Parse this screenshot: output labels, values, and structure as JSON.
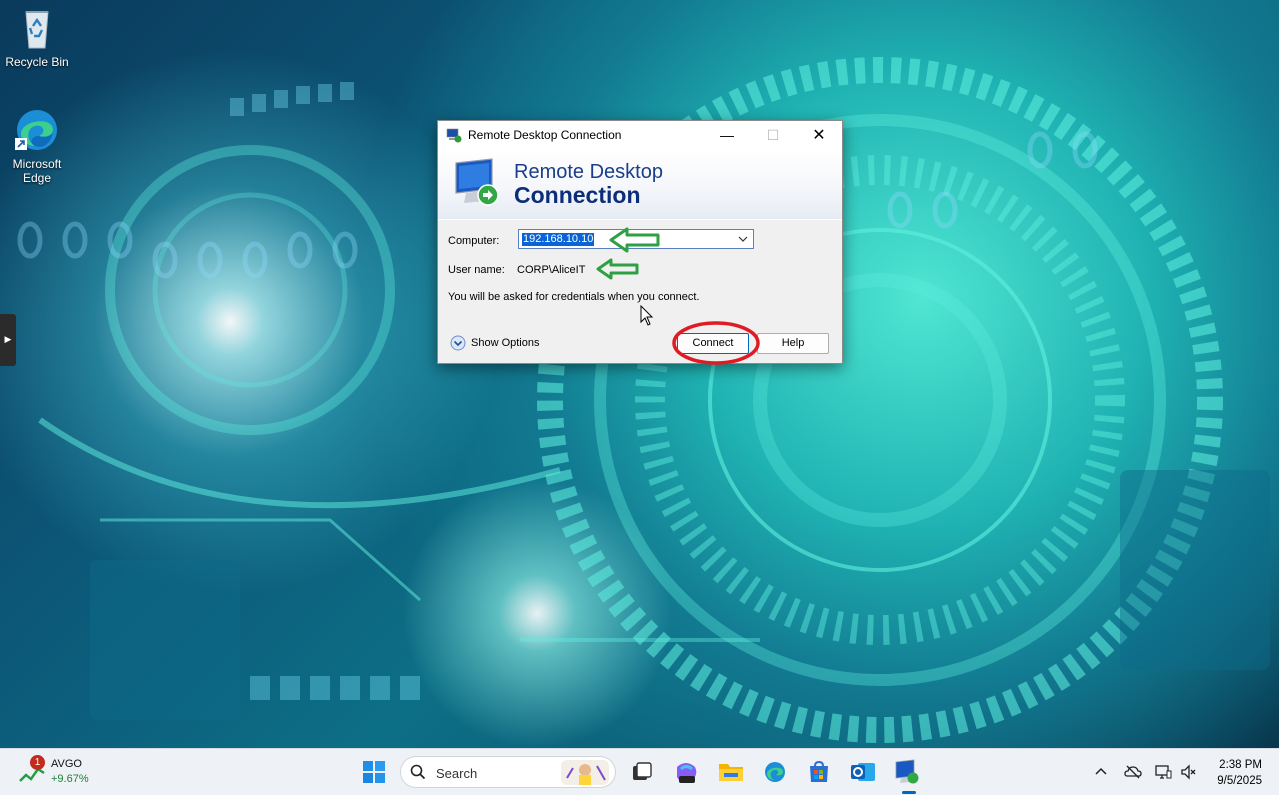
{
  "desktop": {
    "icons": [
      {
        "label": "Recycle Bin",
        "icon": "recycle-bin-icon"
      },
      {
        "label": "Microsoft Edge",
        "label_line1": "Microsoft",
        "label_line2": "Edge",
        "icon": "edge-icon"
      }
    ],
    "side_handle_glyph": "▶"
  },
  "dialog": {
    "title": "Remote Desktop Connection",
    "banner_line1": "Remote Desktop",
    "banner_line2": "Connection",
    "computer_label": "Computer:",
    "computer_value": "192.168.10.10",
    "username_label": "User name:",
    "username_value": "CORP\\AliceIT",
    "info_text": "You will be asked for credentials when you connect.",
    "show_options_label": "Show Options",
    "connect_label": "Connect",
    "help_label": "Help",
    "minimize_glyph": "—",
    "maximize_glyph": "☐",
    "close_glyph": "✕"
  },
  "annotations": {
    "arrow_color": "#2ea043",
    "circle_color": "#e01b24"
  },
  "taskbar": {
    "widget": {
      "badge": "1",
      "ticker": "AVGO",
      "change": "+9.67%"
    },
    "search_placeholder": "Search",
    "pinned": [
      "start-icon",
      "search",
      "task-view-icon",
      "m365-copilot-icon",
      "file-explorer-icon",
      "edge-icon",
      "microsoft-store-icon",
      "outlook-icon",
      "remote-desktop-icon"
    ],
    "tray": [
      "chevron-up-icon",
      "onedrive-icon",
      "network-icon",
      "volume-icon"
    ],
    "time": "2:38 PM",
    "date": "9/5/2025",
    "accent": "#0067c0"
  }
}
